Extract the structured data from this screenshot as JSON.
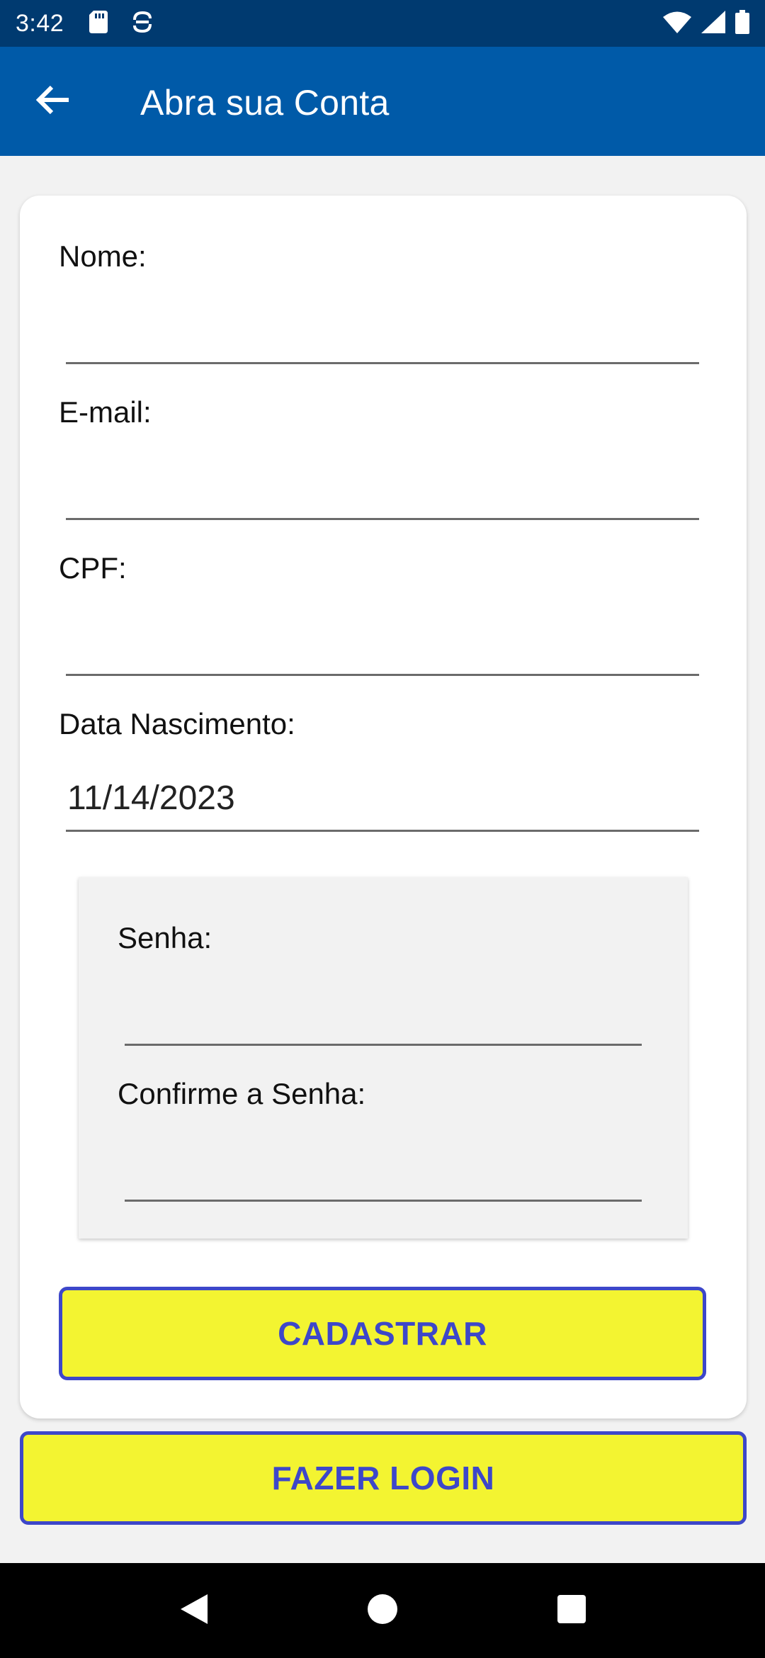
{
  "status_bar": {
    "time": "3:42",
    "icons_left": [
      "sd-card-icon",
      "sync-icon"
    ],
    "icons_right": [
      "wifi-icon",
      "cell-signal-icon",
      "battery-icon"
    ]
  },
  "app_bar": {
    "title": "Abra sua Conta",
    "back_icon": "arrow-left-icon",
    "color": "#005aa8",
    "status_color": "#003a70"
  },
  "form": {
    "nome": {
      "label": "Nome:",
      "value": ""
    },
    "email": {
      "label": "E-mail:",
      "value": ""
    },
    "cpf": {
      "label": "CPF:",
      "value": ""
    },
    "data_nascimento": {
      "label": "Data Nascimento:",
      "value": "11/14/2023"
    },
    "senha": {
      "label": "Senha:",
      "value": ""
    },
    "confirme_senha": {
      "label": "Confirme a Senha:",
      "value": ""
    }
  },
  "buttons": {
    "cadastrar": "CADASTRAR",
    "fazer_login": "FAZER LOGIN",
    "fill_color": "#f3f431",
    "text_color": "#3d47c9"
  },
  "nav_bar": {
    "icons": [
      "back-triangle-icon",
      "home-circle-icon",
      "recents-square-icon"
    ]
  }
}
